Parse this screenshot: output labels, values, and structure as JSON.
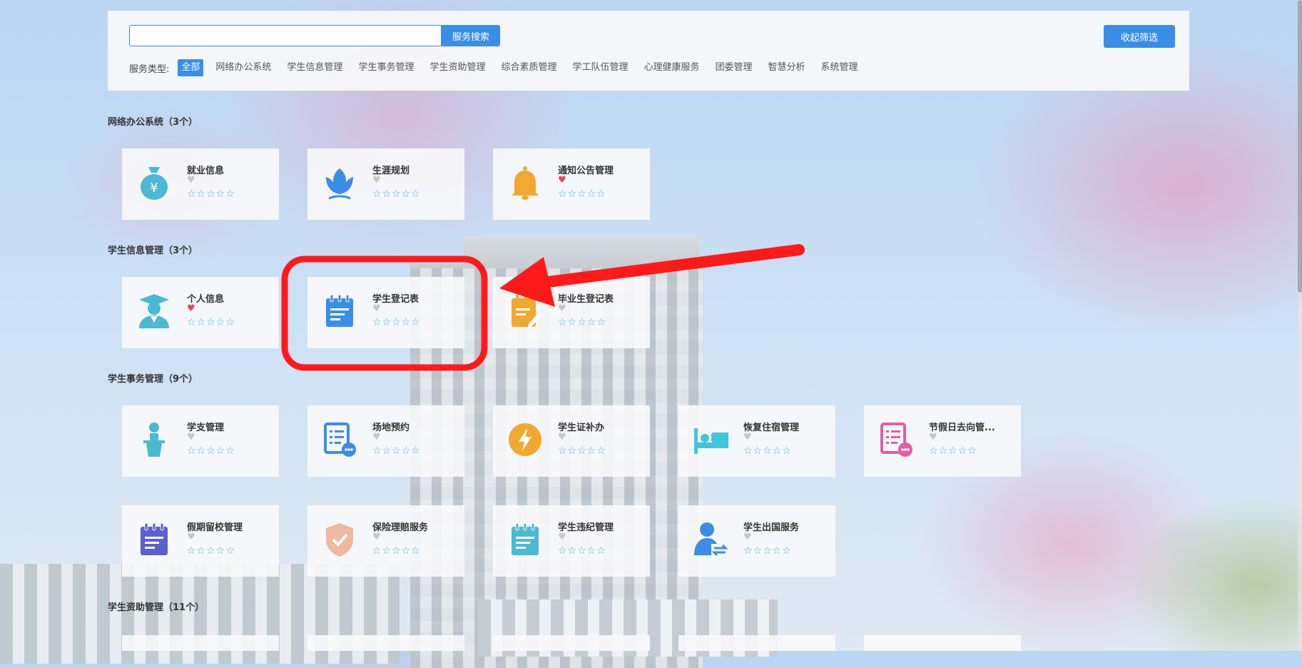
{
  "search": {
    "placeholder": "",
    "value": "",
    "button_label": "服务搜索"
  },
  "collapse_button": "收起筛选",
  "filter": {
    "label": "服务类型:",
    "items": [
      "全部",
      "网络办公系统",
      "学生信息管理",
      "学生事务管理",
      "学生资助管理",
      "综合素质管理",
      "学工队伍管理",
      "心理健康服务",
      "团委管理",
      "智慧分析",
      "系统管理"
    ],
    "active": "全部"
  },
  "sections": {
    "office": {
      "title": "网络办公系统（3个）"
    },
    "info": {
      "title": "学生信息管理（3个）"
    },
    "affairs": {
      "title": "学生事务管理（9个）"
    },
    "aid": {
      "title": "学生资助管理（11个）"
    }
  },
  "cards": [
    {
      "name": "就业信息",
      "icon": "money-bag-icon",
      "color": "#4bb8d4",
      "favorite": false
    },
    {
      "name": "生涯规划",
      "icon": "lotus-icon",
      "color": "#3a8ee6",
      "favorite": false
    },
    {
      "name": "通知公告管理",
      "icon": "bell-icon",
      "color": "#f0a830",
      "favorite": true
    },
    {
      "name": "个人信息",
      "icon": "graduate-icon",
      "color": "#4bb8d4",
      "favorite": true
    },
    {
      "name": "学生登记表",
      "icon": "notebook-icon",
      "color": "#3a8ee6",
      "favorite": false
    },
    {
      "name": "毕业生登记表",
      "icon": "notepad-pen-icon",
      "color": "#f0a830",
      "favorite": false
    },
    {
      "name": "学支管理",
      "icon": "speaker-podium-icon",
      "color": "#4bb8d4",
      "favorite": false
    },
    {
      "name": "场地预约",
      "icon": "list-chat-icon",
      "color": "#3a8ee6",
      "favorite": false
    },
    {
      "name": "学生证补办",
      "icon": "lightning-icon",
      "color": "#f0a830",
      "favorite": false
    },
    {
      "name": "恢复住宿管理",
      "icon": "bed-icon",
      "color": "#3fc6d8",
      "favorite": false
    },
    {
      "name": "节假日去向管...",
      "icon": "list-chat-icon",
      "color": "#e05fa8",
      "favorite": false
    },
    {
      "name": "假期留校管理",
      "icon": "notebook-icon",
      "color": "#5b5fcf",
      "favorite": false
    },
    {
      "name": "保险理赔服务",
      "icon": "shield-check-icon",
      "color": "#f0b8a0",
      "favorite": false
    },
    {
      "name": "学生违纪管理",
      "icon": "notebook-icon",
      "color": "#4bb8d4",
      "favorite": false
    },
    {
      "name": "学生出国服务",
      "icon": "person-exchange-icon",
      "color": "#3a8ee6",
      "favorite": false
    }
  ],
  "stars_text": "☆☆☆☆☆",
  "heart_glyph": "♥",
  "annotation": {
    "color": "#ff1a1a"
  }
}
